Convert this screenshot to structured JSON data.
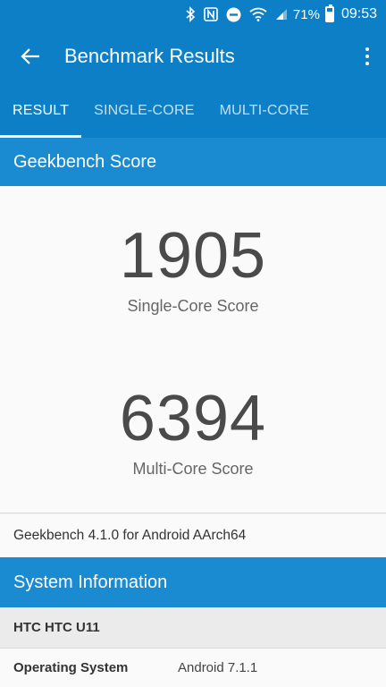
{
  "status_bar": {
    "battery_percent": "71%",
    "battery_level": 0.71,
    "time": "09:53",
    "icons": [
      "bluetooth-icon",
      "nfc-icon",
      "do-not-disturb-icon",
      "wifi-icon",
      "signal-icon",
      "battery-icon"
    ]
  },
  "app_bar": {
    "title": "Benchmark Results"
  },
  "tabs": [
    {
      "label": "RESULT",
      "active": true
    },
    {
      "label": "SINGLE-CORE",
      "active": false
    },
    {
      "label": "MULTI-CORE",
      "active": false
    }
  ],
  "geekbench_score": {
    "header": "Geekbench Score",
    "single_core_value": "1905",
    "single_core_label": "Single-Core Score",
    "multi_core_value": "6394",
    "multi_core_label": "Multi-Core Score"
  },
  "version": "Geekbench 4.1.0 for Android AArch64",
  "system_information": {
    "header": "System Information",
    "device": "HTC HTC U11",
    "rows": [
      {
        "key": "Operating System",
        "value": "Android 7.1.1"
      }
    ]
  },
  "colors": {
    "primary": "#0d7fc6",
    "section_header": "#1a8ad1"
  }
}
